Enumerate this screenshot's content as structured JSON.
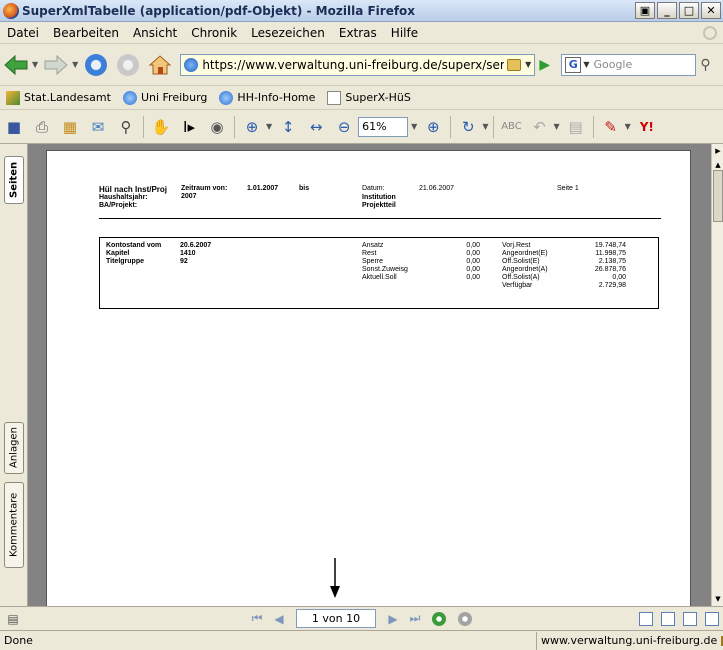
{
  "window": {
    "title": "SuperXmlTabelle (application/pdf-Objekt) - Mozilla Firefox"
  },
  "menu": [
    "Datei",
    "Bearbeiten",
    "Ansicht",
    "Chronik",
    "Lesezeichen",
    "Extras",
    "Hilfe"
  ],
  "nav": {
    "url": "https://www.verwaltung.uni-freiburg.de/superx/servlet/Supe",
    "search_placeholder": "Google"
  },
  "bookmarks": [
    "Stat.Landesamt",
    "Uni Freiburg",
    "HH-Info-Home",
    "SuperX-HüS"
  ],
  "pdf_toolbar": {
    "zoom": "61%"
  },
  "side_tabs": {
    "pages": "Seiten",
    "attachments": "Anlagen",
    "comments": "Kommentare"
  },
  "doc": {
    "header": {
      "title": "Hül nach Inst/Proj",
      "haushaltsjahr_label": "Haushaltsjahr:",
      "haushaltsjahr_value": "2007",
      "ba_label": "BA/Projekt:",
      "zeitraum_label": "Zeitraum von:",
      "zeitraum_from": "1.01.2007",
      "zeitraum_bis": "bis",
      "datum_label": "Datum:",
      "datum_value": "21.06.2007",
      "institution_label": "Institution",
      "projektteil_label": "Projektteil",
      "seite": "Seite 1"
    },
    "summary": {
      "left": [
        {
          "label": "Kontostand vom",
          "value": "20.6.2007"
        },
        {
          "label": "Kapitel",
          "value": "1410"
        },
        {
          "label": "Titelgruppe",
          "value": "92"
        }
      ],
      "middle": [
        {
          "label": "Ansatz",
          "value": "0,00"
        },
        {
          "label": "Rest",
          "value": "0,00"
        },
        {
          "label": "Sperre",
          "value": "0,00"
        },
        {
          "label": "Sonst.Zuweisg",
          "value": "0,00"
        },
        {
          "label": "Aktuell.Soll",
          "value": "0,00"
        }
      ],
      "right": [
        {
          "label": "Vorj.Rest",
          "value": "19.748,74"
        },
        {
          "label": "Angeordnet(E)",
          "value": "11.998,75"
        },
        {
          "label": "Off.Solist(E)",
          "value": "2.138,75"
        },
        {
          "label": "Angeordnet(A)",
          "value": "26.878,76"
        },
        {
          "label": "Off.Solist(A)",
          "value": "0,00"
        },
        {
          "label": "Verfügbar",
          "value": "2.729,98"
        }
      ]
    }
  },
  "pager": {
    "page_display": "1 von 10"
  },
  "status": {
    "left": "Done",
    "right": "www.verwaltung.uni-freiburg.de"
  }
}
